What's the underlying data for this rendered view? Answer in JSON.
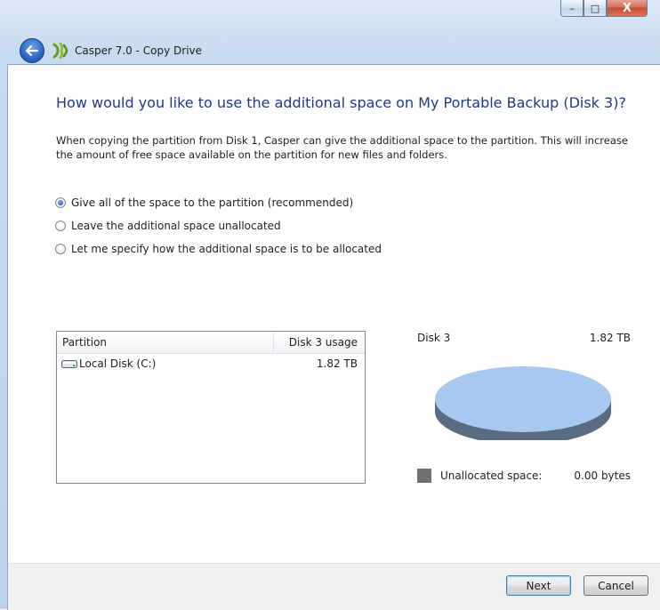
{
  "window": {
    "title": "Casper 7.0 - Copy Drive",
    "caption_buttons": {
      "minimize": "–",
      "maximize": "□",
      "close": "X"
    }
  },
  "heading": "How would you like to use the additional space on My Portable Backup (Disk 3)?",
  "description": "When copying the partition from Disk 1, Casper can give the additional space to the partition. This will increase the amount of free space available on the partition for new files and folders.",
  "options": [
    {
      "label": "Give all of the space to the partition (recommended)",
      "selected": true
    },
    {
      "label": "Leave the additional space unallocated",
      "selected": false
    },
    {
      "label": "Let me specify how the additional space is to be allocated",
      "selected": false
    }
  ],
  "table": {
    "headers": [
      "Partition",
      "Disk 3 usage"
    ],
    "rows": [
      {
        "partition": "Local Disk (C:)",
        "usage": "1.82 TB"
      }
    ]
  },
  "disk_panel": {
    "disk_name": "Disk 3",
    "disk_size": "1.82 TB",
    "pie_color": "#a7c8ef",
    "pie_side_color": "#5a6c82",
    "legend": {
      "label": "Unallocated space:",
      "value": "0.00 bytes",
      "color": "#707070"
    }
  },
  "buttons": {
    "next": "Next",
    "cancel": "Cancel"
  }
}
